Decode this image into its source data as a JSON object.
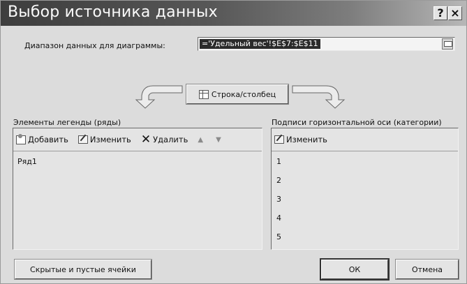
{
  "window": {
    "title": "Выбор источника данных",
    "help_button": "?",
    "close_button": "×"
  },
  "range": {
    "label": "Диапазон данных для диаграммы:",
    "value": "='Удельный вес'!$E$7:$E$11"
  },
  "switch_button": {
    "label": "Строка/столбец"
  },
  "legend": {
    "label": "Элементы легенды (ряды)",
    "add_label": "Добавить",
    "edit_label": "Изменить",
    "delete_label": "Удалить",
    "up_icon": "▲",
    "down_icon": "▼",
    "items": [
      "Ряд1"
    ]
  },
  "axis": {
    "label": "Подписи горизонтальной оси (категории)",
    "edit_label": "Изменить",
    "items": [
      "1",
      "2",
      "3",
      "4",
      "5"
    ]
  },
  "buttons": {
    "hidden_cells": "Скрытые и пустые ячейки",
    "ok": "ОК",
    "cancel": "Отмена"
  },
  "colors": {
    "dialog_background": "#dcdcdc",
    "selected_range": "#2b2b2b"
  }
}
